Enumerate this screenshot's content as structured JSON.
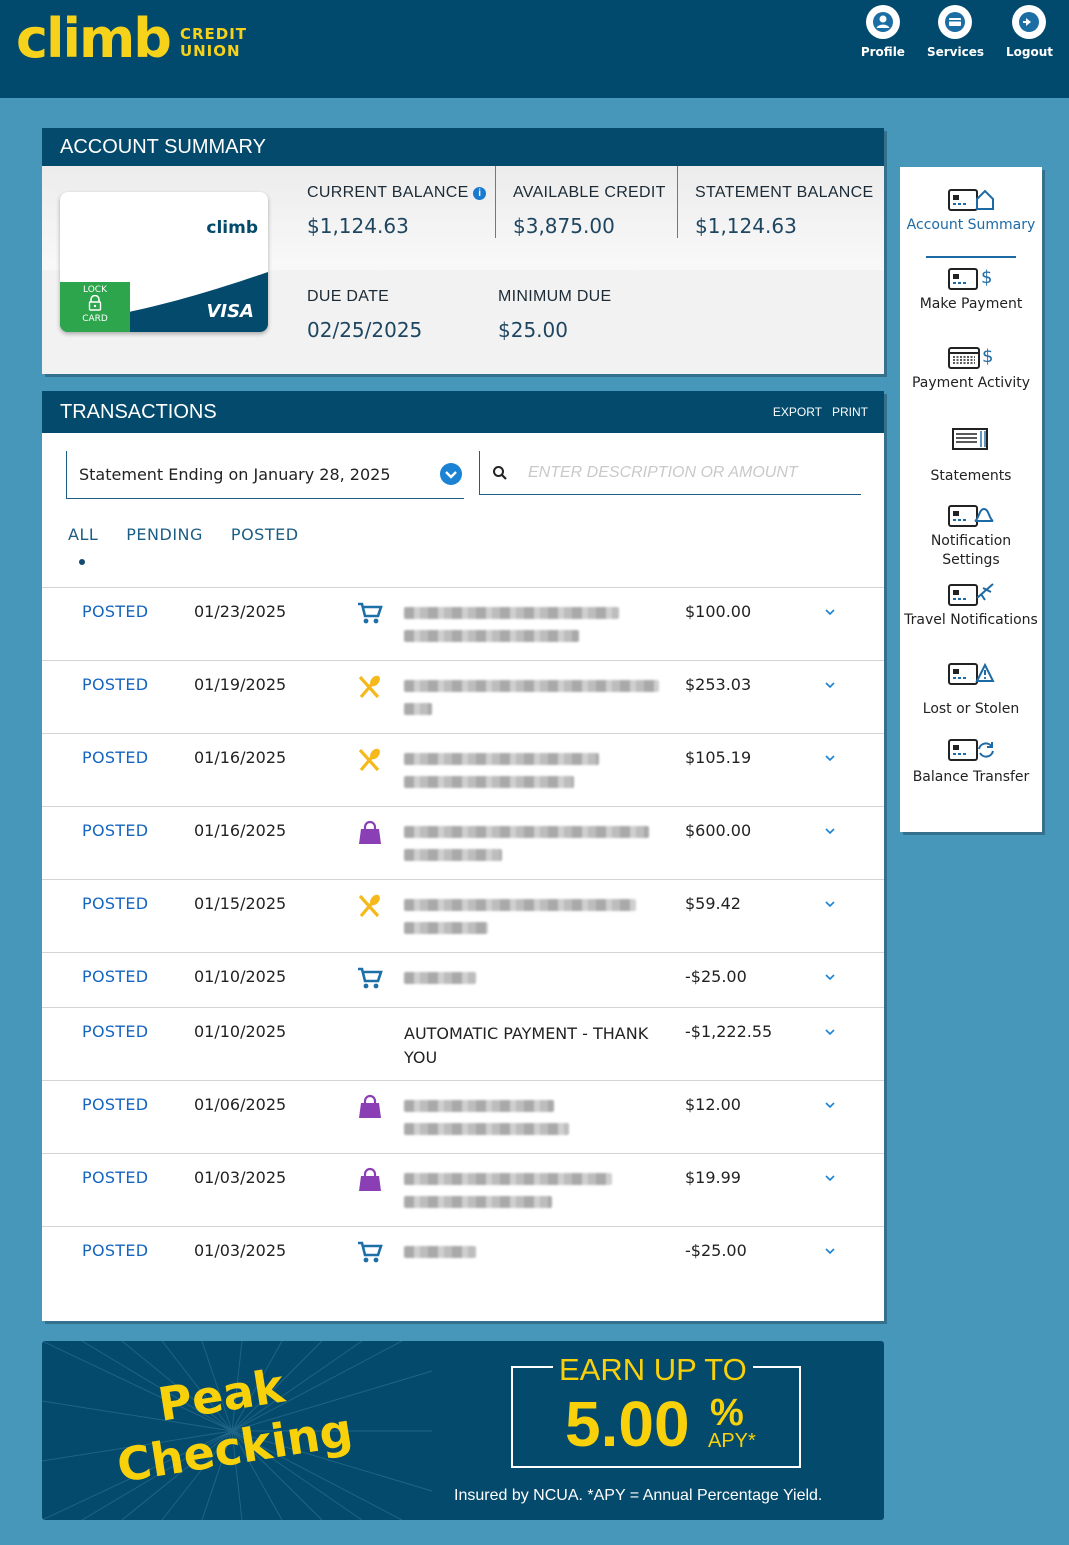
{
  "header": {
    "brand_word": "climb",
    "brand_sub_1": "CREDIT",
    "brand_sub_2": "UNION",
    "nav": [
      {
        "label": "Profile",
        "icon": "user-icon"
      },
      {
        "label": "Services",
        "icon": "card-icon"
      },
      {
        "label": "Logout",
        "icon": "logout-icon"
      }
    ]
  },
  "summary": {
    "title": "ACCOUNT SUMMARY",
    "card": {
      "brand": "climb",
      "lock_top": "LOCK",
      "lock_bottom": "CARD",
      "network": "VISA"
    },
    "current_balance_label": "CURRENT BALANCE",
    "current_balance": "$1,124.63",
    "available_credit_label": "AVAILABLE CREDIT",
    "available_credit": "$3,875.00",
    "statement_balance_label": "STATEMENT BALANCE",
    "statement_balance": "$1,124.63",
    "due_date_label": "DUE DATE",
    "due_date": "02/25/2025",
    "minimum_due_label": "MINIMUM DUE",
    "minimum_due": "$25.00"
  },
  "transactions": {
    "title": "TRANSACTIONS",
    "export_label": "EXPORT",
    "print_label": "PRINT",
    "statement_select": "Statement Ending on January 28, 2025",
    "search_placeholder": "ENTER DESCRIPTION OR AMOUNT",
    "tabs": [
      "ALL",
      "PENDING",
      "POSTED"
    ],
    "rows": [
      {
        "status": "POSTED",
        "date": "01/23/2025",
        "category": "cart-icon",
        "description": "",
        "amount": "$100.00"
      },
      {
        "status": "POSTED",
        "date": "01/19/2025",
        "category": "dining-icon",
        "description": "",
        "amount": "$253.03"
      },
      {
        "status": "POSTED",
        "date": "01/16/2025",
        "category": "dining-icon",
        "description": "",
        "amount": "$105.19"
      },
      {
        "status": "POSTED",
        "date": "01/16/2025",
        "category": "shopping-bag-icon",
        "description": "",
        "amount": "$600.00"
      },
      {
        "status": "POSTED",
        "date": "01/15/2025",
        "category": "dining-icon",
        "description": "",
        "amount": "$59.42"
      },
      {
        "status": "POSTED",
        "date": "01/10/2025",
        "category": "cart-icon",
        "description": "",
        "amount": "-$25.00"
      },
      {
        "status": "POSTED",
        "date": "01/10/2025",
        "category": "",
        "description": "AUTOMATIC PAYMENT - THANK YOU",
        "amount": "-$1,222.55"
      },
      {
        "status": "POSTED",
        "date": "01/06/2025",
        "category": "shopping-bag-icon",
        "description": "",
        "amount": "$12.00"
      },
      {
        "status": "POSTED",
        "date": "01/03/2025",
        "category": "shopping-bag-icon",
        "description": "",
        "amount": "$19.99"
      },
      {
        "status": "POSTED",
        "date": "01/03/2025",
        "category": "cart-icon",
        "description": "",
        "amount": "-$25.00"
      }
    ]
  },
  "sidebar": {
    "items": [
      {
        "label": "Account Summary",
        "icon": "account-summary-icon",
        "active": true
      },
      {
        "label": "Make Payment",
        "icon": "make-payment-icon"
      },
      {
        "label": "Payment Activity",
        "icon": "payment-activity-icon"
      },
      {
        "label": "Statements",
        "icon": "statements-icon"
      },
      {
        "label": "Notification Settings",
        "icon": "notification-icon"
      },
      {
        "label": "Travel Notifications",
        "icon": "travel-icon"
      },
      {
        "label": "Lost or Stolen",
        "icon": "warning-icon"
      },
      {
        "label": "Balance Transfer",
        "icon": "balance-transfer-icon"
      }
    ]
  },
  "promo": {
    "word1": "Peak",
    "word2": "Checking",
    "earn": "EARN UP TO",
    "rate": "5.00",
    "pct": "%",
    "apy": "APY*",
    "footnote": "Insured by NCUA. *APY = Annual Percentage Yield."
  },
  "colors": {
    "page_bg": "#4797bb",
    "header_bg": "#024a6d",
    "brand_yellow": "#f7d21a",
    "link_blue": "#1565c0",
    "lock_green": "#2da54c",
    "cart_blue": "#1c6fa7",
    "dining_yellow": "#f5b91c",
    "bag_purple": "#8a3fb4"
  }
}
